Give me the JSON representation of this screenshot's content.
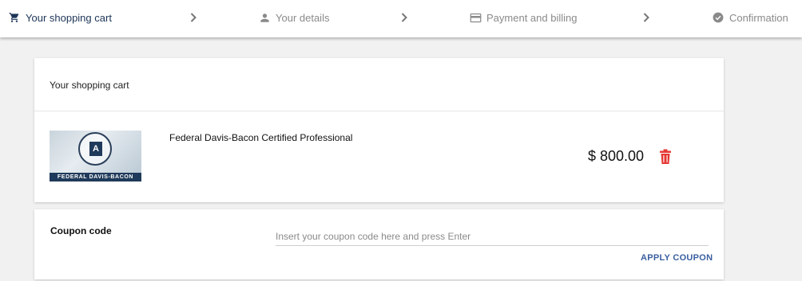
{
  "stepper": {
    "steps": [
      {
        "label": "Your shopping cart",
        "icon": "shopping-cart-icon",
        "active": true
      },
      {
        "label": "Your details",
        "icon": "person-icon",
        "active": false
      },
      {
        "label": "Payment and billing",
        "icon": "credit-card-icon",
        "active": false
      },
      {
        "label": "Confirmation",
        "icon": "check-circle-icon",
        "active": false
      }
    ]
  },
  "cart": {
    "title": "Your shopping cart",
    "items": [
      {
        "name": "Federal Davis-Bacon Certified Professional",
        "price": "$ 800.00",
        "thumb_badge": "A",
        "thumb_band": "FEDERAL DAVIS-BACON"
      }
    ]
  },
  "coupon": {
    "label": "Coupon code",
    "placeholder": "Insert your coupon code here and press Enter",
    "value": "",
    "apply_label": "APPLY COUPON"
  },
  "colors": {
    "active_step": "#1d3557",
    "inactive_step": "#8a8a8a",
    "delete_icon": "#e53935",
    "apply_link": "#3a5fa0"
  }
}
